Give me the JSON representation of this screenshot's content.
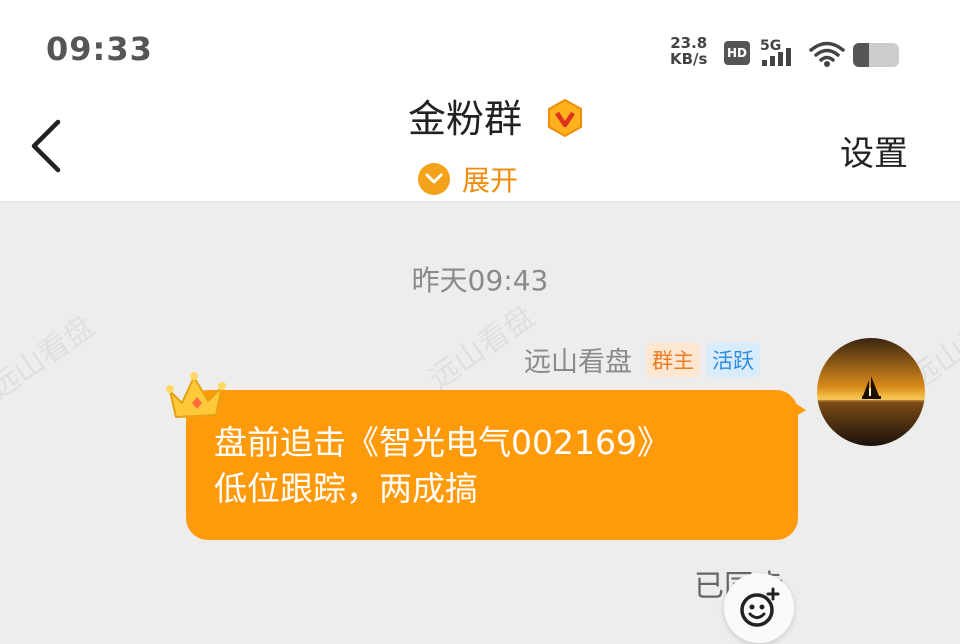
{
  "status_bar": {
    "time": "09:33",
    "net_speed_value": "23.8",
    "net_speed_unit": "KB/s",
    "hd_label": "HD",
    "network_label": "5G",
    "battery_level": 0.35
  },
  "nav": {
    "title": "金粉群",
    "expand_label": "展开",
    "settings_label": "设置"
  },
  "chat": {
    "watermark": "远山看盘",
    "timestamp": "昨天09:43",
    "message": {
      "sender": "远山看盘",
      "tags": [
        "群主",
        "活跃"
      ],
      "line1": "盘前追击《智光电气002169》",
      "line2": "低位跟踪，两成搞",
      "status": "已同步"
    }
  },
  "colors": {
    "accent": "#ff9a0a",
    "expand_orange": "#f5a21b",
    "owner_tag": "#ee7b1d",
    "active_tag": "#2f8de0"
  },
  "icons": [
    "back-arrow-icon",
    "vip-badge-icon",
    "chevron-down-icon",
    "crown-icon",
    "emoji-add-icon",
    "wifi-icon",
    "signal-icon",
    "battery-icon"
  ]
}
